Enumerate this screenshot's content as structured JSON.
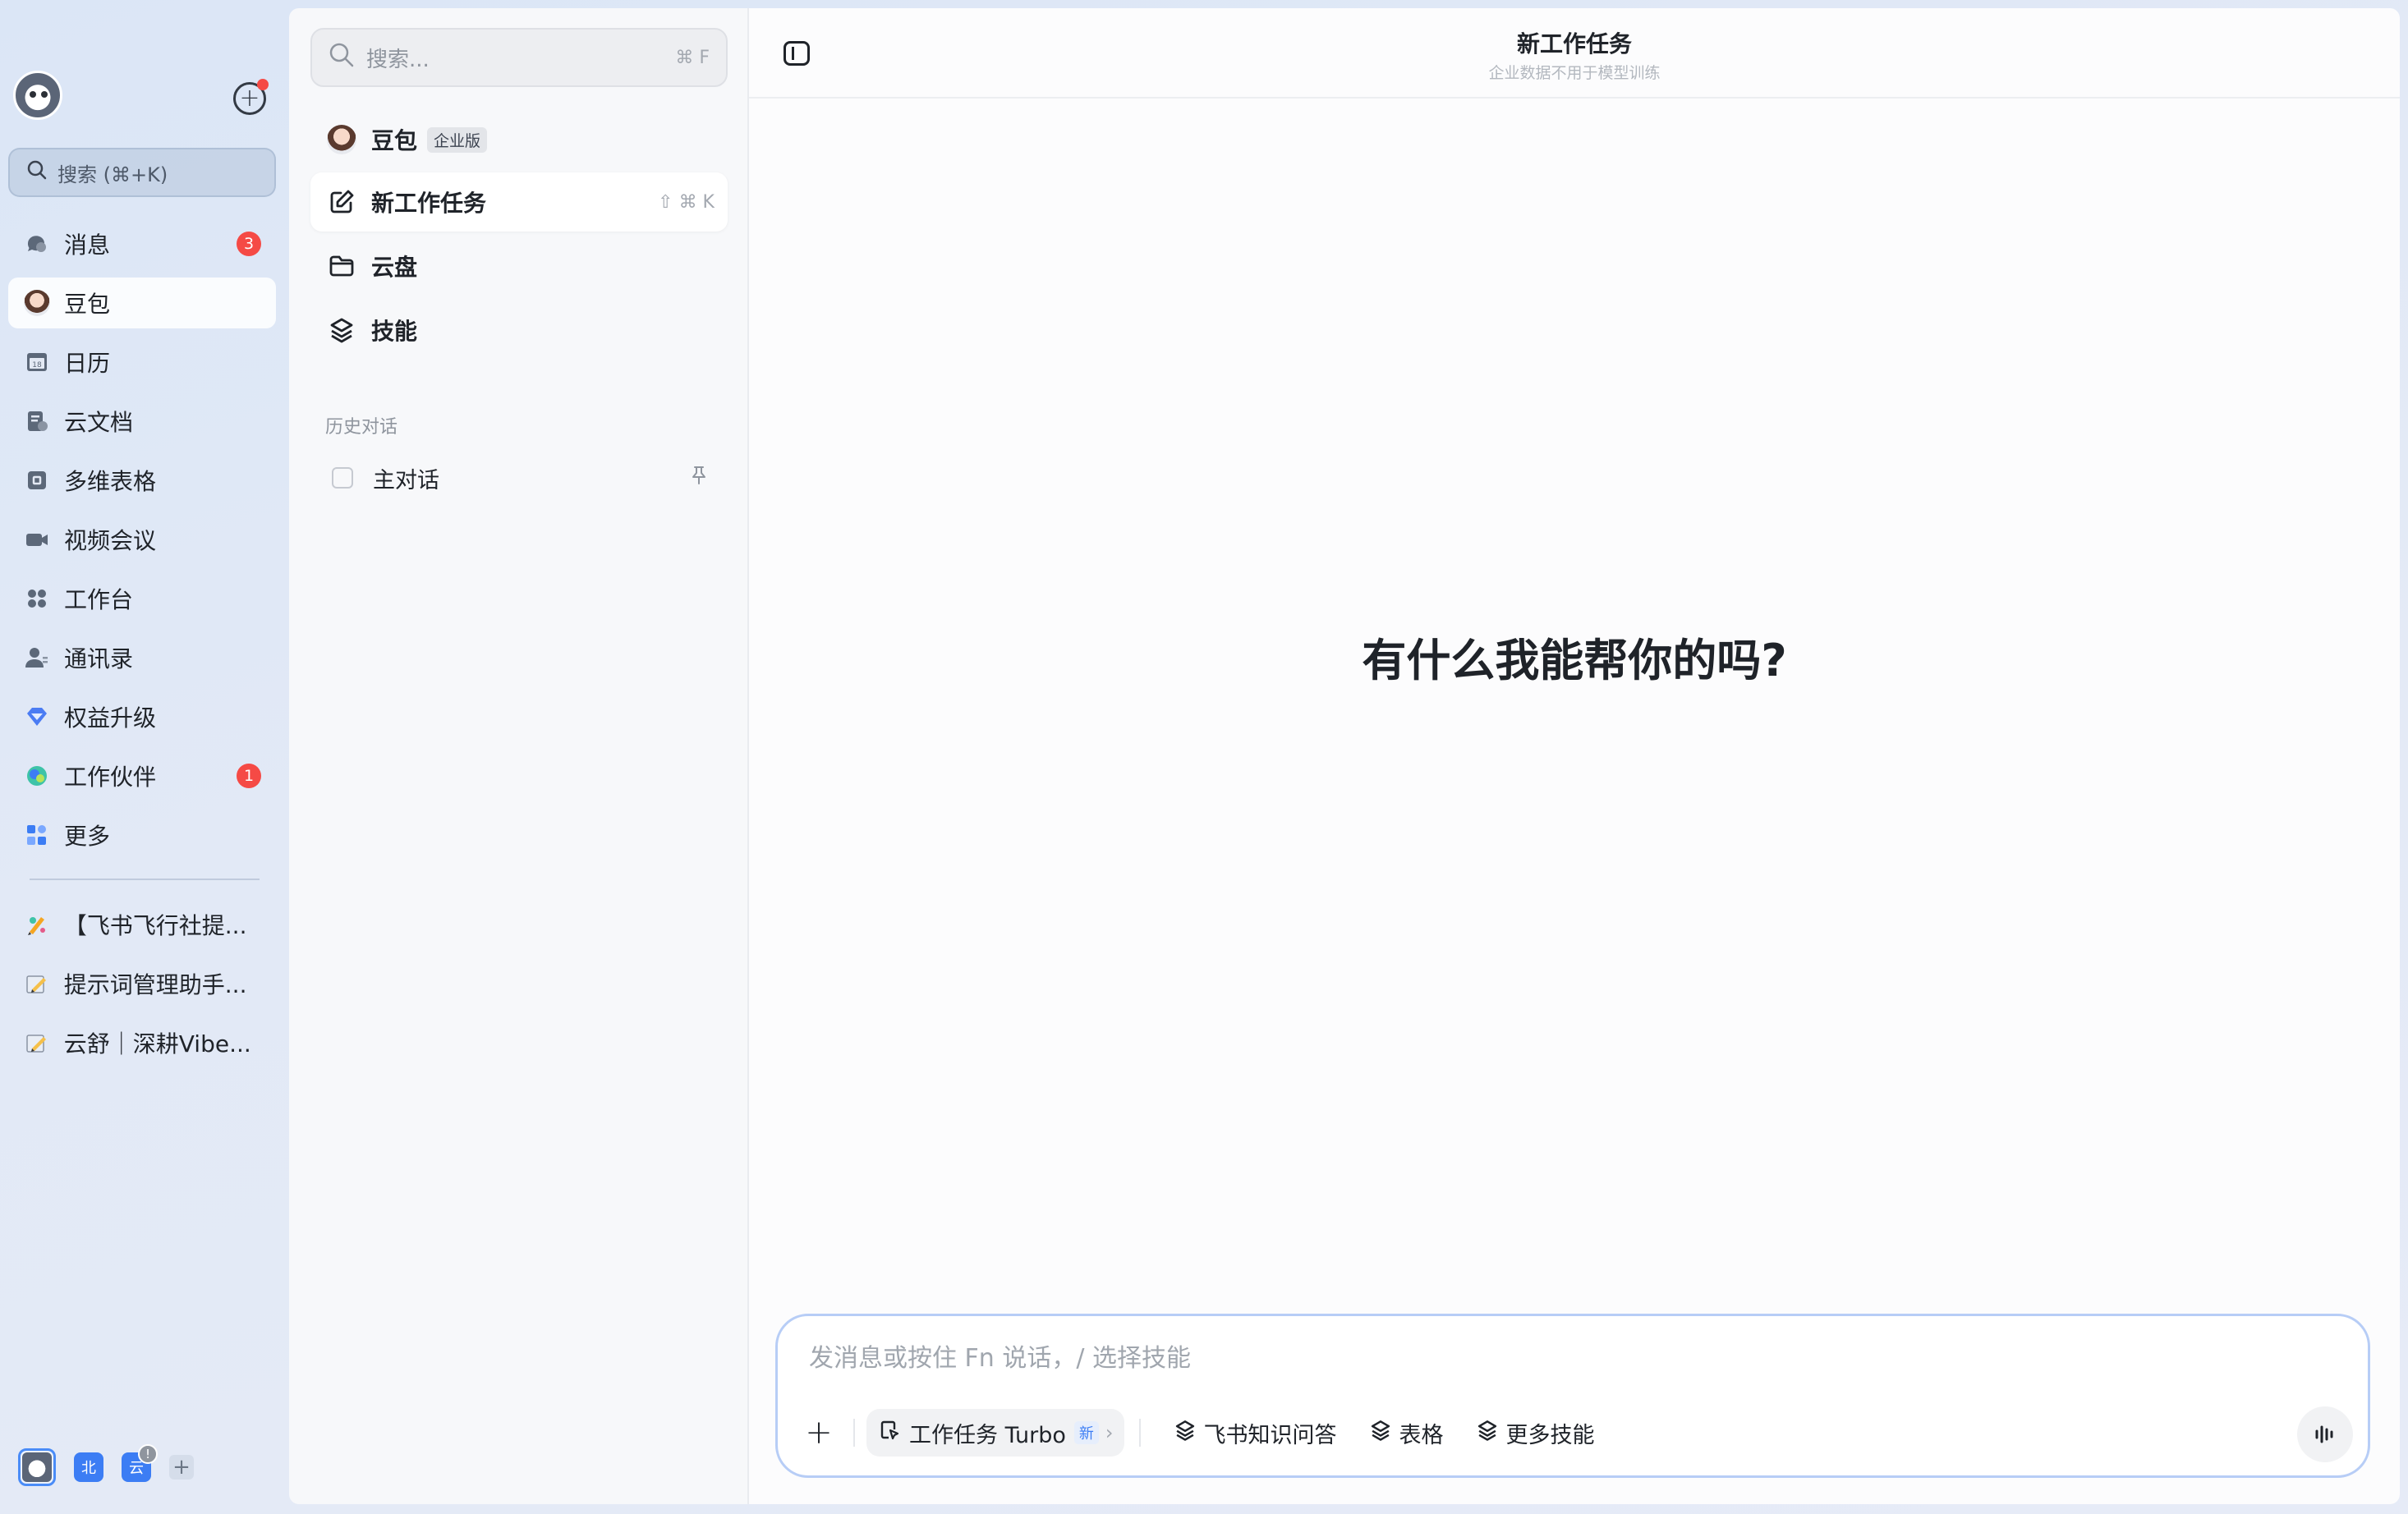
{
  "leftnav": {
    "search_label": "搜索 (⌘+K)",
    "items": [
      {
        "label": "消息",
        "icon": "chat-bubble-icon",
        "badge": "3"
      },
      {
        "label": "豆包",
        "icon": "doubao-avatar-icon",
        "active": true
      },
      {
        "label": "日历",
        "icon": "calendar-icon",
        "icon_text": "18"
      },
      {
        "label": "云文档",
        "icon": "cloud-doc-icon"
      },
      {
        "label": "多维表格",
        "icon": "base-table-icon"
      },
      {
        "label": "视频会议",
        "icon": "video-camera-icon"
      },
      {
        "label": "工作台",
        "icon": "workplace-grid-icon"
      },
      {
        "label": "通讯录",
        "icon": "contacts-icon"
      },
      {
        "label": "权益升级",
        "icon": "diamond-icon"
      },
      {
        "label": "工作伙伴",
        "icon": "partner-icon",
        "badge": "1"
      },
      {
        "label": "更多",
        "icon": "more-apps-icon"
      }
    ],
    "recent": [
      {
        "label": "【飞书飞行社提...",
        "icon": "doc-colorful-icon"
      },
      {
        "label": "提示词管理助手...",
        "icon": "doc-pencil-icon"
      },
      {
        "label": "云舒｜深耕Vibe...",
        "icon": "doc-pencil-icon"
      }
    ],
    "footer": {
      "tenant_1": "北",
      "tenant_2": "云",
      "add": "+"
    }
  },
  "panel2": {
    "search_placeholder": "搜索...",
    "search_shortcut": "⌘ F",
    "doubao_label": "豆包",
    "enterprise_badge": "企业版",
    "new_task_label": "新工作任务",
    "new_task_shortcut": "⇧ ⌘ K",
    "drive_label": "云盘",
    "skills_label": "技能",
    "history_label": "历史对话",
    "history_items": [
      {
        "label": "主对话"
      }
    ]
  },
  "main": {
    "title": "新工作任务",
    "subtitle": "企业数据不用于模型训练",
    "greeting": "有什么我能帮你的吗?",
    "composer": {
      "placeholder": "发消息或按住 Fn 说话，/ 选择技能",
      "value": "",
      "turbo_label": "工作任务 Turbo",
      "turbo_new": "新",
      "skills": [
        "飞书知识问答",
        "表格",
        "更多技能"
      ]
    }
  },
  "colors": {
    "accent": "#3c7df4",
    "badge": "#f54a45",
    "composer_border": "#b7cdf6"
  }
}
